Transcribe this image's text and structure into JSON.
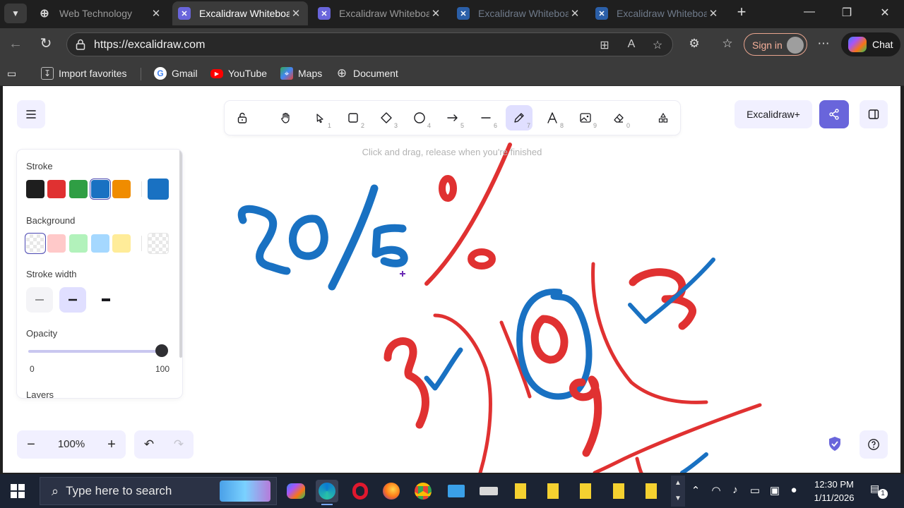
{
  "browser": {
    "tabs": [
      {
        "title": "Web Technology",
        "icon": "globe-icon",
        "active": false
      },
      {
        "title": "Excalidraw Whiteboard",
        "icon": "excalidraw-icon",
        "active": true
      },
      {
        "title": "Excalidraw Whiteboard",
        "icon": "excalidraw-icon",
        "active": false
      },
      {
        "title": "Excalidraw Whiteboard",
        "icon": "excalidraw-icon",
        "active": false
      },
      {
        "title": "Excalidraw Whiteboard",
        "icon": "excalidraw-icon",
        "active": false
      }
    ],
    "url": "https://excalidraw.com",
    "signin_label": "Sign in",
    "chat_label": "Chat",
    "favorites": [
      {
        "label": "Import favorites",
        "icon": "import-icon"
      },
      {
        "label": "Gmail",
        "icon": "google-icon"
      },
      {
        "label": "YouTube",
        "icon": "youtube-icon"
      },
      {
        "label": "Maps",
        "icon": "maps-icon"
      },
      {
        "label": "Document",
        "icon": "globe-icon"
      }
    ]
  },
  "excalidraw": {
    "tools": [
      {
        "name": "lock",
        "key": ""
      },
      {
        "name": "hand",
        "key": ""
      },
      {
        "name": "selection",
        "key": "1"
      },
      {
        "name": "rectangle",
        "key": "2"
      },
      {
        "name": "diamond",
        "key": "3"
      },
      {
        "name": "ellipse",
        "key": "4"
      },
      {
        "name": "arrow",
        "key": "5"
      },
      {
        "name": "line",
        "key": "6"
      },
      {
        "name": "draw",
        "key": "7",
        "selected": true
      },
      {
        "name": "text",
        "key": "8"
      },
      {
        "name": "image",
        "key": "9"
      },
      {
        "name": "eraser",
        "key": "0"
      },
      {
        "name": "more-shapes",
        "key": ""
      }
    ],
    "hint": "Click and drag, release when you're finished",
    "plus_label": "Excalidraw+",
    "properties": {
      "stroke_label": "Stroke",
      "stroke_colors": [
        "#1e1e1e",
        "#e03131",
        "#2f9e44",
        "#1971c2",
        "#f08c00"
      ],
      "stroke_selected": "#1971c2",
      "background_label": "Background",
      "background_colors": [
        "transparent",
        "#ffc9c9",
        "#b2f2bb",
        "#a5d8ff",
        "#ffec99"
      ],
      "background_selected": "transparent",
      "stroke_width_label": "Stroke width",
      "stroke_width_selected": "bold",
      "opacity_label": "Opacity",
      "opacity_min": "0",
      "opacity_max": "100",
      "opacity_value": 100,
      "layers_label": "Layers"
    },
    "zoom_label": "100%"
  },
  "taskbar": {
    "search_placeholder": "Type here to search",
    "time": "12:30 PM",
    "date": "1/11/2026",
    "notification_count": "1"
  }
}
